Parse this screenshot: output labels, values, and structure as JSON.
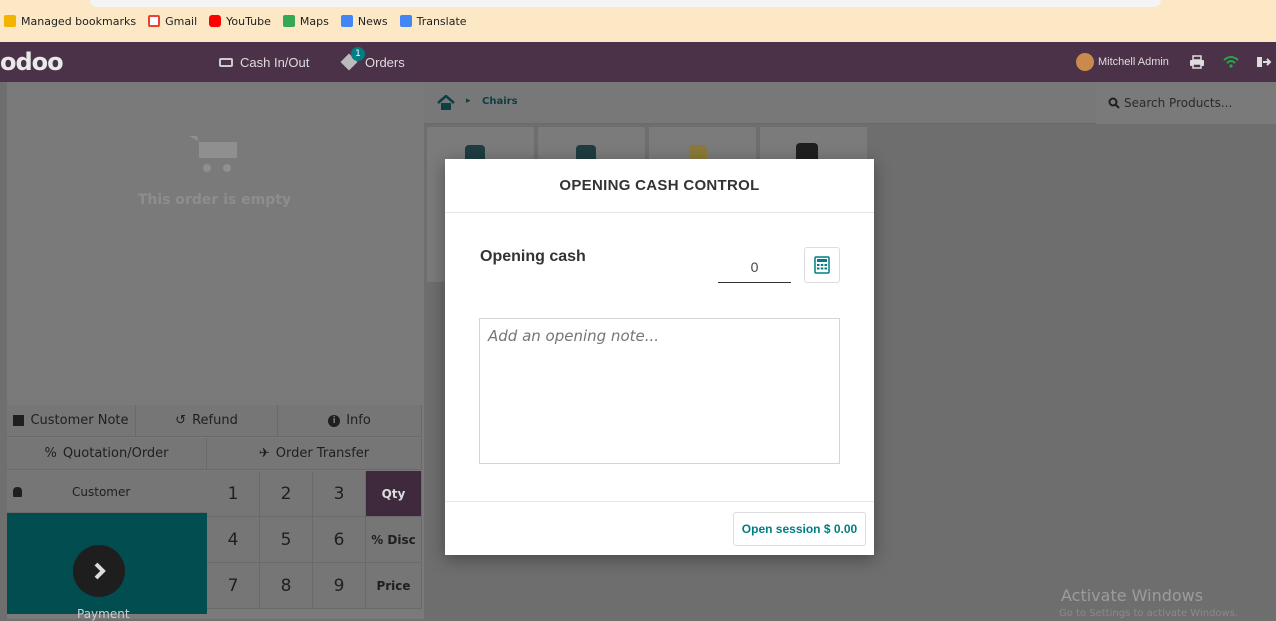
{
  "bookmarks": [
    {
      "label": "Managed bookmarks",
      "icon": "folder-icon",
      "color": "#f3b400"
    },
    {
      "label": "Gmail",
      "icon": "gmail-icon",
      "color": "#ea4335"
    },
    {
      "label": "YouTube",
      "icon": "youtube-icon",
      "color": "#ff0000"
    },
    {
      "label": "Maps",
      "icon": "maps-icon",
      "color": "#34a853"
    },
    {
      "label": "News",
      "icon": "news-icon",
      "color": "#4285f4"
    },
    {
      "label": "Translate",
      "icon": "translate-icon",
      "color": "#4285f4"
    }
  ],
  "topbar": {
    "logo": "odoo",
    "cash_label": "Cash In/Out",
    "orders_label": "Orders",
    "orders_badge": "1",
    "user_name": "Mitchell Admin",
    "colors": {
      "bar": "#4b3248",
      "badge": "#017e84"
    }
  },
  "order": {
    "empty_text": "This order is empty"
  },
  "controls": {
    "customer_note": "Customer Note",
    "refund": "Refund",
    "info": "Info",
    "quotation": "Quotation/Order",
    "order_transfer": "Order Transfer"
  },
  "numpad": {
    "customer": "Customer",
    "payment": "Payment",
    "keys": [
      "1",
      "2",
      "3",
      "4",
      "5",
      "6",
      "7",
      "8",
      "9"
    ],
    "modes": [
      "Qty",
      "% Disc",
      "Price"
    ],
    "active_mode": "Qty"
  },
  "products": {
    "breadcrumb": "Chairs",
    "search_placeholder": "Search Products..."
  },
  "modal": {
    "title": "OPENING CASH CONTROL",
    "opening_cash_label": "Opening cash",
    "opening_cash_value": "0",
    "note_placeholder": "Add an opening note...",
    "open_button": "Open session $ 0.00",
    "accent": "#017e84"
  },
  "watermark": {
    "title": "Activate Windows",
    "subtitle": "Go to Settings to activate Windows."
  }
}
